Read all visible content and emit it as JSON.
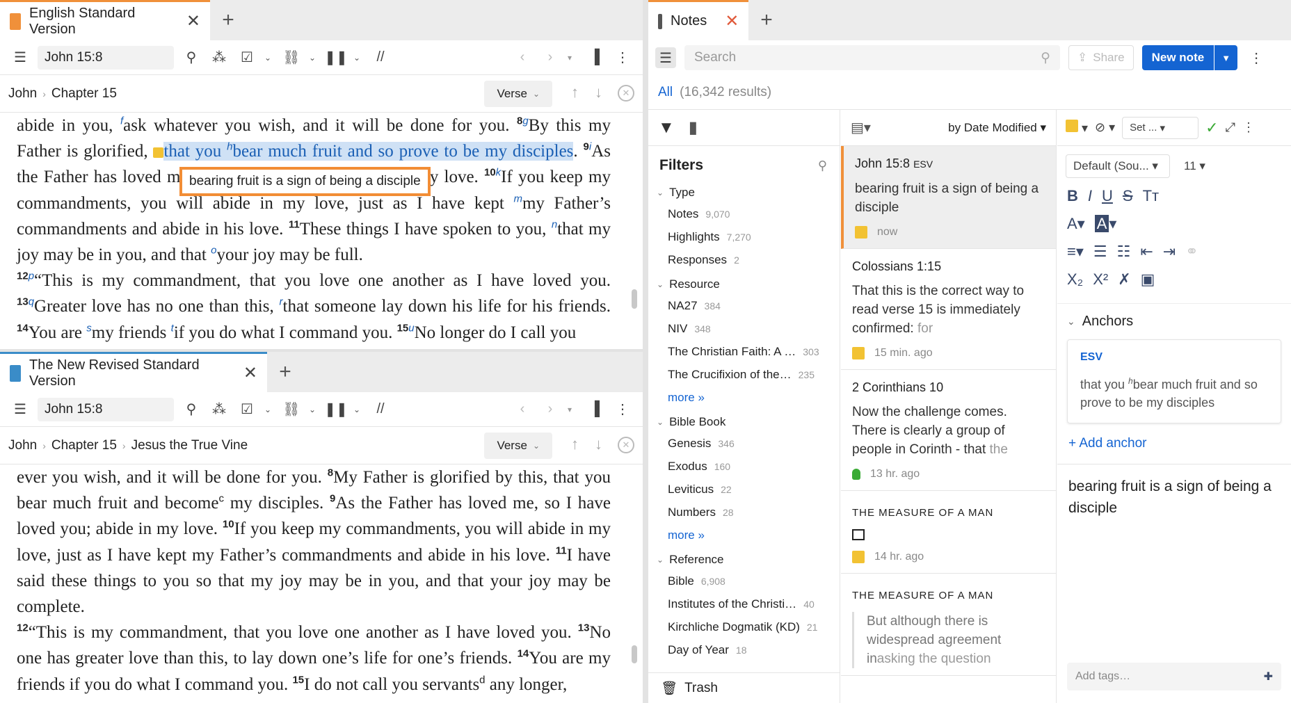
{
  "top_pane": {
    "tab_title": "English Standard Version",
    "reference": "John 15:8",
    "crumbs": [
      "John",
      "Chapter 15"
    ],
    "verse_btn": "Verse",
    "tooltip": "bearing fruit is a sign of being a disciple"
  },
  "bottom_pane": {
    "tab_title": "The New Revised Standard Version",
    "reference": "John 15:8",
    "crumbs": [
      "John",
      "Chapter 15",
      "Jesus the True Vine"
    ],
    "verse_btn": "Verse"
  },
  "notes_pane": {
    "tab_title": "Notes",
    "search_placeholder": "Search",
    "share_label": "Share",
    "new_note_label": "New note",
    "results_all": "All",
    "results_count": "(16,342 results)",
    "filters_title": "Filters",
    "sort_label": "by Date Modified",
    "more": "more »",
    "trash": "Trash",
    "filter_groups": [
      {
        "title": "Type",
        "items": [
          {
            "label": "Notes",
            "count": "9,070"
          },
          {
            "label": "Highlights",
            "count": "7,270"
          },
          {
            "label": "Responses",
            "count": "2"
          }
        ]
      },
      {
        "title": "Resource",
        "items": [
          {
            "label": "NA27",
            "count": "384"
          },
          {
            "label": "NIV",
            "count": "348"
          },
          {
            "label": "The Christian Faith: A …",
            "count": "303"
          },
          {
            "label": "The Crucifixion of the…",
            "count": "235"
          }
        ]
      },
      {
        "title": "Bible Book",
        "items": [
          {
            "label": "Genesis",
            "count": "346"
          },
          {
            "label": "Exodus",
            "count": "160"
          },
          {
            "label": "Leviticus",
            "count": "22"
          },
          {
            "label": "Numbers",
            "count": "28"
          }
        ]
      },
      {
        "title": "Reference",
        "items": [
          {
            "label": "Bible",
            "count": "6,908"
          },
          {
            "label": "Institutes of the Christi…",
            "count": "40"
          },
          {
            "label": "Kirchliche Dogmatik (KD)",
            "count": "21"
          },
          {
            "label": "Day of Year",
            "count": "18"
          }
        ]
      }
    ],
    "notes": [
      {
        "ref": "John 15:8",
        "ref_tag": "ESV",
        "body": "bearing fruit is a sign of being a disciple",
        "time": "now"
      },
      {
        "ref": "Colossians 1:15",
        "body": "That this is the correct way to read verse 15 is immediately confirmed: ",
        "fade": "for",
        "time": "15 min. ago"
      },
      {
        "ref": "2 Corinthians 10",
        "body": "Now the challenge comes. There is clearly a group of people in Corinth - that ",
        "fade": "the",
        "time": "13 hr. ago"
      },
      {
        "title": "THE MEASURE OF A MAN",
        "time": "14 hr. ago"
      },
      {
        "title": "THE MEASURE OF A MAN",
        "body": "But although there is widespread agreement in",
        "fade": "asking the question"
      }
    ],
    "editor": {
      "set_label": "Set ...",
      "font_label": "Default (Sou...",
      "size_label": "11",
      "anchors_title": "Anchors",
      "anchor_version": "ESV",
      "anchor_text_a": "that you ",
      "anchor_sup": "h",
      "anchor_text_b": "bear much fruit and so prove to be my disciples",
      "add_anchor": "+ Add anchor",
      "content": "bearing fruit is a sign of being a disciple",
      "tags_placeholder": "Add tags…"
    }
  }
}
